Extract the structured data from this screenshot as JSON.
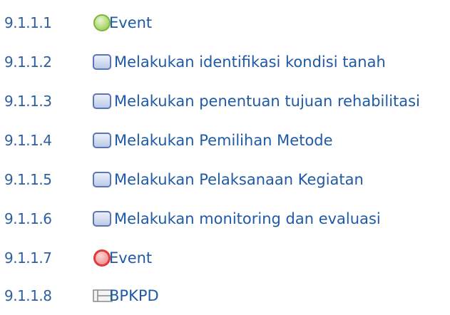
{
  "items": [
    {
      "number": "9.1.1.1",
      "label": "Event",
      "icon": "start-event-icon"
    },
    {
      "number": "9.1.1.2",
      "label": "Melakukan identifikasi kondisi tanah",
      "icon": "task-icon"
    },
    {
      "number": "9.1.1.3",
      "label": "Melakukan penentuan tujuan rehabilitasi",
      "icon": "task-icon"
    },
    {
      "number": "9.1.1.4",
      "label": "Melakukan Pemilihan Metode",
      "icon": "task-icon"
    },
    {
      "number": "9.1.1.5",
      "label": "Melakukan Pelaksanaan Kegiatan",
      "icon": "task-icon"
    },
    {
      "number": "9.1.1.6",
      "label": "Melakukan monitoring dan evaluasi",
      "icon": "task-icon"
    },
    {
      "number": "9.1.1.7",
      "label": "Event",
      "icon": "end-event-icon"
    },
    {
      "number": "9.1.1.8",
      "label": "BPKPD",
      "icon": "lane-icon"
    }
  ],
  "colors": {
    "number_text": "#2e5f9e",
    "label_text": "#1f5aa6",
    "start_event": "#8cc63f",
    "end_event": "#e03a3a",
    "task_fill": "#c8d4ec",
    "task_border": "#5b76b5",
    "lane_border": "#8a8a8a"
  }
}
